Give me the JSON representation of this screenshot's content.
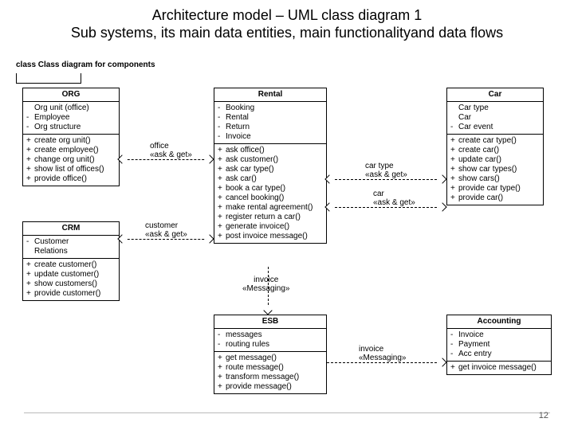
{
  "title_line1": "Architecture model – UML class diagram 1",
  "title_line2": "Sub systems, its main data entities, main functionalityand data flows",
  "diagram_label": "class Class diagram for components",
  "page_number": "12",
  "classes": {
    "org": {
      "name": "ORG",
      "attrs": [
        {
          "v": "",
          "n": "Org unit (office)"
        },
        {
          "v": "-",
          "n": "Employee"
        },
        {
          "v": "-",
          "n": "Org structure"
        }
      ],
      "ops": [
        {
          "v": "+",
          "n": "create org unit()"
        },
        {
          "v": "+",
          "n": "create employee()"
        },
        {
          "v": "+",
          "n": "change org unit()"
        },
        {
          "v": "+",
          "n": "show list of offices()"
        },
        {
          "v": "+",
          "n": "provide office()"
        }
      ]
    },
    "crm": {
      "name": "CRM",
      "attrs": [
        {
          "v": "-",
          "n": "Customer"
        },
        {
          "v": "",
          "n": "Relations"
        }
      ],
      "ops": [
        {
          "v": "+",
          "n": "create customer()"
        },
        {
          "v": "+",
          "n": "update customer()"
        },
        {
          "v": "+",
          "n": "show customers()"
        },
        {
          "v": "+",
          "n": "provide customer()"
        }
      ]
    },
    "rental": {
      "name": "Rental",
      "attrs": [
        {
          "v": "-",
          "n": "Booking"
        },
        {
          "v": "-",
          "n": "Rental"
        },
        {
          "v": "-",
          "n": "Return"
        },
        {
          "v": "-",
          "n": "Invoice"
        }
      ],
      "ops": [
        {
          "v": "+",
          "n": "ask office()"
        },
        {
          "v": "+",
          "n": "ask customer()"
        },
        {
          "v": "+",
          "n": "ask car type()"
        },
        {
          "v": "+",
          "n": "ask car()"
        },
        {
          "v": "+",
          "n": "book a car type()"
        },
        {
          "v": "+",
          "n": "cancel booking()"
        },
        {
          "v": "+",
          "n": "make rental agreement()"
        },
        {
          "v": "+",
          "n": "register return a car()"
        },
        {
          "v": "+",
          "n": "generate invoice()"
        },
        {
          "v": "+",
          "n": "post invoice message()"
        }
      ]
    },
    "car": {
      "name": "Car",
      "attrs": [
        {
          "v": "",
          "n": "Car type"
        },
        {
          "v": "",
          "n": "Car"
        },
        {
          "v": "-",
          "n": "Car event"
        }
      ],
      "ops": [
        {
          "v": "+",
          "n": "create car type()"
        },
        {
          "v": "+",
          "n": "create car()"
        },
        {
          "v": "+",
          "n": "update car()"
        },
        {
          "v": "+",
          "n": "show car types()"
        },
        {
          "v": "+",
          "n": "show cars()"
        },
        {
          "v": "+",
          "n": "provide car type()"
        },
        {
          "v": "+",
          "n": "provide car()"
        }
      ]
    },
    "esb": {
      "name": "ESB",
      "attrs": [
        {
          "v": "-",
          "n": "messages"
        },
        {
          "v": "-",
          "n": "routing rules"
        }
      ],
      "ops": [
        {
          "v": "+",
          "n": "get message()"
        },
        {
          "v": "+",
          "n": "route message()"
        },
        {
          "v": "+",
          "n": "transform message()"
        },
        {
          "v": "+",
          "n": "provide message()"
        }
      ]
    },
    "accounting": {
      "name": "Accounting",
      "attrs": [
        {
          "v": "-",
          "n": "Invoice"
        },
        {
          "v": "-",
          "n": "Payment"
        },
        {
          "v": "-",
          "n": "Acc entry"
        }
      ],
      "ops": [
        {
          "v": "+",
          "n": "get invoice message()"
        }
      ]
    }
  },
  "assoc": {
    "office": "office\n«ask & get»",
    "customer": "customer\n«ask & get»",
    "cartype": "car type\n«ask & get»",
    "car": "car\n«ask & get»",
    "invoice_down": "invoice\n«Messaging»",
    "invoice_right": "invoice\n«Messaging»"
  }
}
